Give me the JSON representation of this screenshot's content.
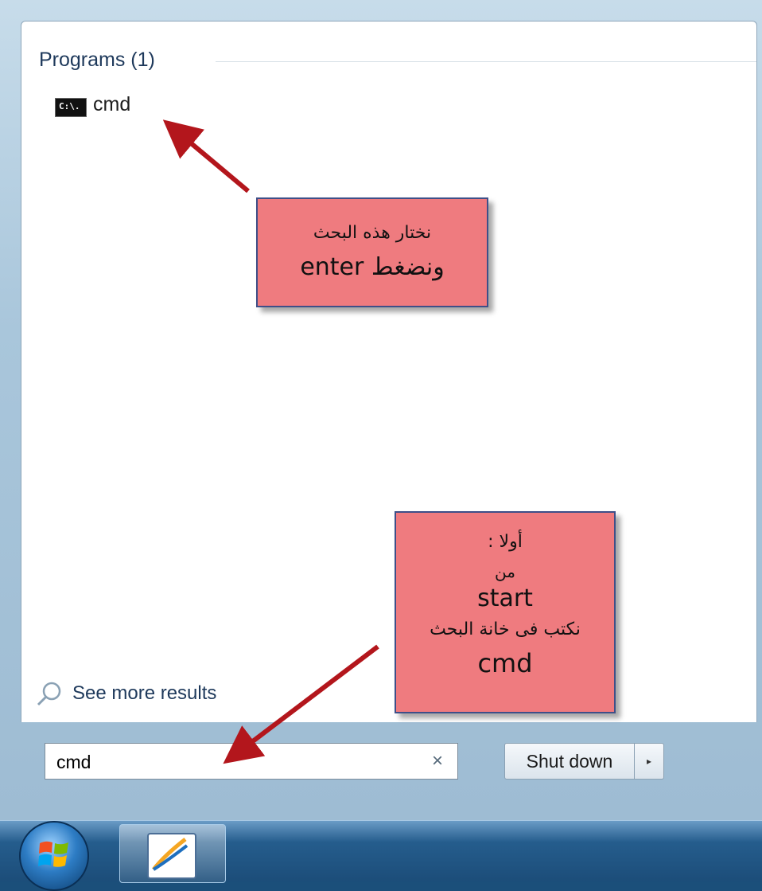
{
  "programs_section": {
    "title": "Programs (1)",
    "results": [
      {
        "label": "cmd",
        "icon": "command-prompt-icon"
      }
    ]
  },
  "see_more": {
    "label": "See more results",
    "icon": "search-icon"
  },
  "search": {
    "value": "cmd",
    "clear_icon": "×"
  },
  "shutdown": {
    "label": "Shut down",
    "arrow": "▸"
  },
  "callouts": {
    "first": {
      "line1": "نختار هذه البحث",
      "line2": "ونضغط enter"
    },
    "second": {
      "line1": "أولا :",
      "line2": "من",
      "line3": "start",
      "line4": "نكتب فى خانة البحث",
      "line5": "cmd"
    }
  },
  "colors": {
    "callout_fill": "#ef7b7f",
    "callout_border": "#3e4f88",
    "arrow": "#b3161c",
    "programs_title": "#1e395b"
  }
}
